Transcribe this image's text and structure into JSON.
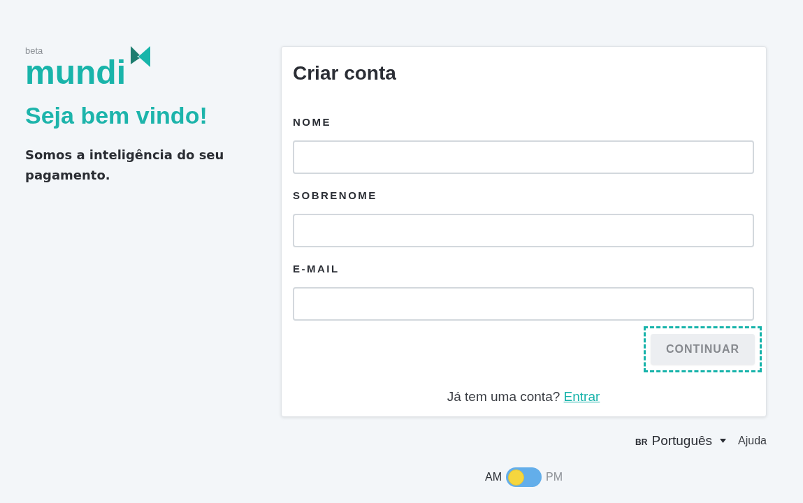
{
  "brand": {
    "badge": "beta",
    "name": "mundi"
  },
  "welcome": {
    "title": "Seja bem vindo!",
    "tagline": "Somos a inteligência do seu pagamento."
  },
  "signup_form": {
    "title": "Criar conta",
    "fields": [
      {
        "label": "NOME"
      },
      {
        "label": "SOBRENOME"
      },
      {
        "label": "E-MAIL"
      }
    ],
    "submit_button": {
      "label": "CONTINUAR",
      "disabled": true,
      "focused": true
    },
    "login_prompt": {
      "text": "Já tem uma conta?",
      "link": "Entrar"
    }
  },
  "footer": {
    "language": {
      "region": "BR",
      "label": "Português"
    },
    "help_link": "Ajuda"
  },
  "period_toggle": {
    "options": [
      {
        "label": "AM",
        "selected": true
      },
      {
        "label": "PM",
        "selected": false
      }
    ]
  }
}
